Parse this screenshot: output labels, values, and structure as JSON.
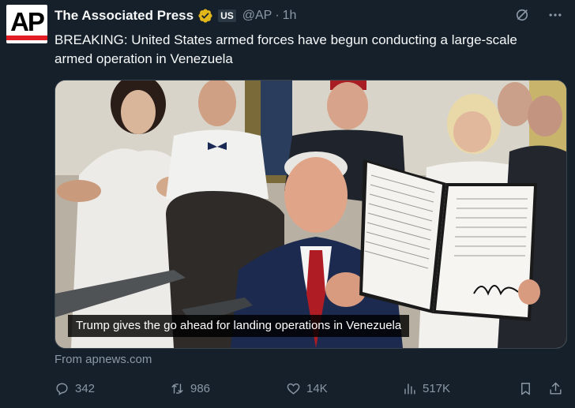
{
  "author": {
    "name": "The Associated Press",
    "logo_text": "AP",
    "country_badge": "US",
    "handle": "@AP",
    "separator": "·",
    "time": "1h"
  },
  "tweet": {
    "text": "BREAKING: United States armed forces have begun conducting a large-scale armed operation in Venezuela"
  },
  "media": {
    "caption": "Trump gives the go ahead for landing operations in Venezuela"
  },
  "source": "From apnews.com",
  "actions": {
    "replies": "342",
    "reposts": "986",
    "likes": "14K",
    "views": "517K"
  },
  "icons": {
    "verified": "gold-checkmark-icon",
    "grok": "grok-icon",
    "more": "more-icon",
    "reply": "reply-icon",
    "repost": "repost-icon",
    "like": "heart-icon",
    "views": "analytics-icon",
    "bookmark": "bookmark-icon",
    "share": "share-icon"
  },
  "colors": {
    "background": "#15202b",
    "text": "#f7f9f9",
    "muted": "#8b98a5",
    "ap_red": "#e21d24",
    "verified_gold": "#e2b719"
  }
}
